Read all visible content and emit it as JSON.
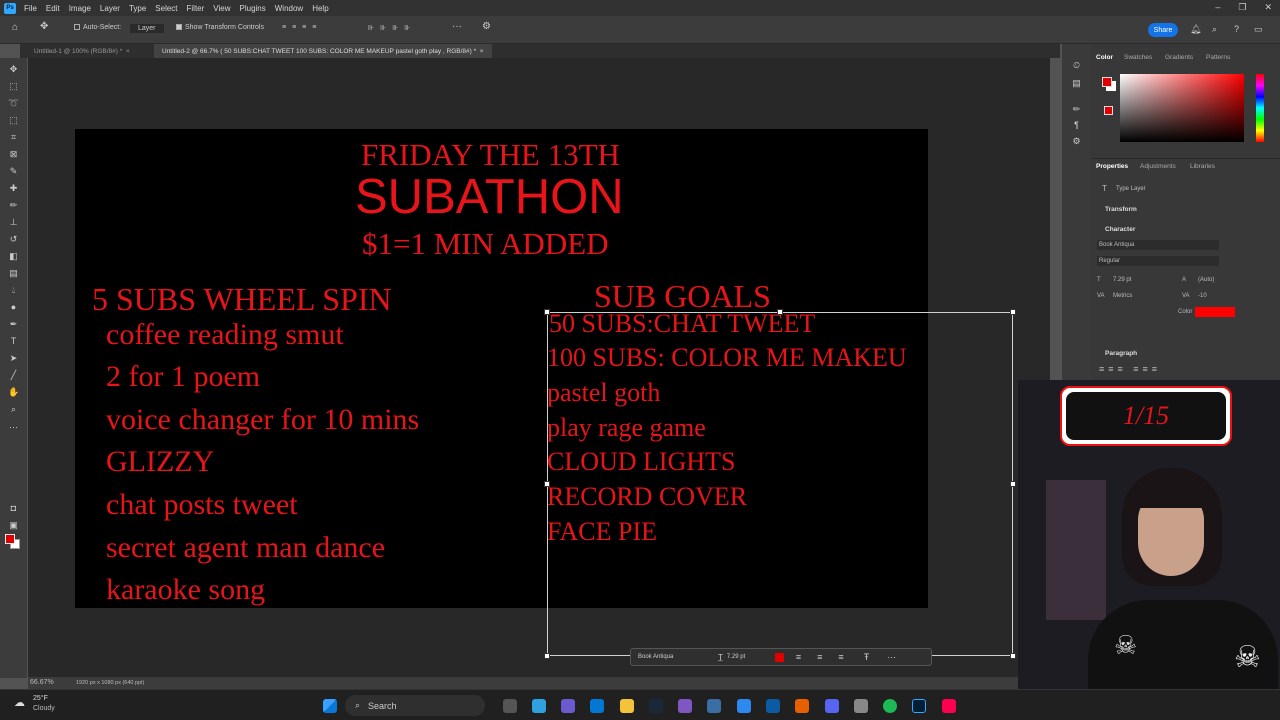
{
  "app": {
    "logo_text": "Ps"
  },
  "menu": [
    "File",
    "Edit",
    "Image",
    "Layer",
    "Type",
    "Select",
    "Filter",
    "View",
    "Plugins",
    "Window",
    "Help"
  ],
  "options": {
    "auto_select": "Auto-Select:",
    "layer_select": "Layer",
    "transform_controls": "Show Transform Controls",
    "share": "Share"
  },
  "tabs": [
    {
      "label": "Untitled-1 @ 100% (RGB/8#) *"
    },
    {
      "label": "Untitled-2 @ 66.7% ( 50 SUBS:CHAT TWEET 100 SUBS: COLOR ME MAKEUP pastel goth play , RGB/8#) *"
    }
  ],
  "canvas": {
    "title1": "FRIDAY THE 13TH",
    "title2": "SUBATHON",
    "title3": "$1=1 MIN ADDED",
    "left_heading": "5 SUBS WHEEL SPIN",
    "left_items": [
      "coffee reading smut",
      "2 for 1 poem",
      "voice changer for 10 mins",
      "GLIZZY",
      "chat posts tweet",
      "secret agent man dance",
      "karaoke song"
    ],
    "right_heading": "SUB GOALS",
    "right_items": [
      " 50 SUBS:CHAT TWEET",
      "100 SUBS: COLOR ME MAKEU",
      "pastel goth",
      "play rage game",
      "CLOUD LIGHTS",
      "RECORD COVER",
      "FACE PIE"
    ],
    "text_color": "#e8141a"
  },
  "context_bar": {
    "font": "Book Antiqua",
    "size": "7.29 pt"
  },
  "status": {
    "zoom": "66.67%",
    "doc_info": "1920 px x 1080 px (640 ppi)"
  },
  "panels": {
    "color_tabs": [
      "Color",
      "Swatches",
      "Gradients",
      "Patterns"
    ],
    "prop_tabs": [
      "Properties",
      "Adjustments",
      "Libraries"
    ],
    "type_layer": "Type Layer",
    "transform": "Transform",
    "character": "Character",
    "font": "Book Antiqua",
    "style": "Regular",
    "size": "7.29 pt",
    "leading": "(Auto)",
    "kerning": "Metrics",
    "tracking": "-10",
    "color_label": "Color",
    "paragraph": "Paragraph",
    "accent": "#ff0000"
  },
  "overlay": {
    "counter": "1/15"
  },
  "taskbar": {
    "temp": "25°F",
    "weather": "Cloudy",
    "search": "Search"
  }
}
